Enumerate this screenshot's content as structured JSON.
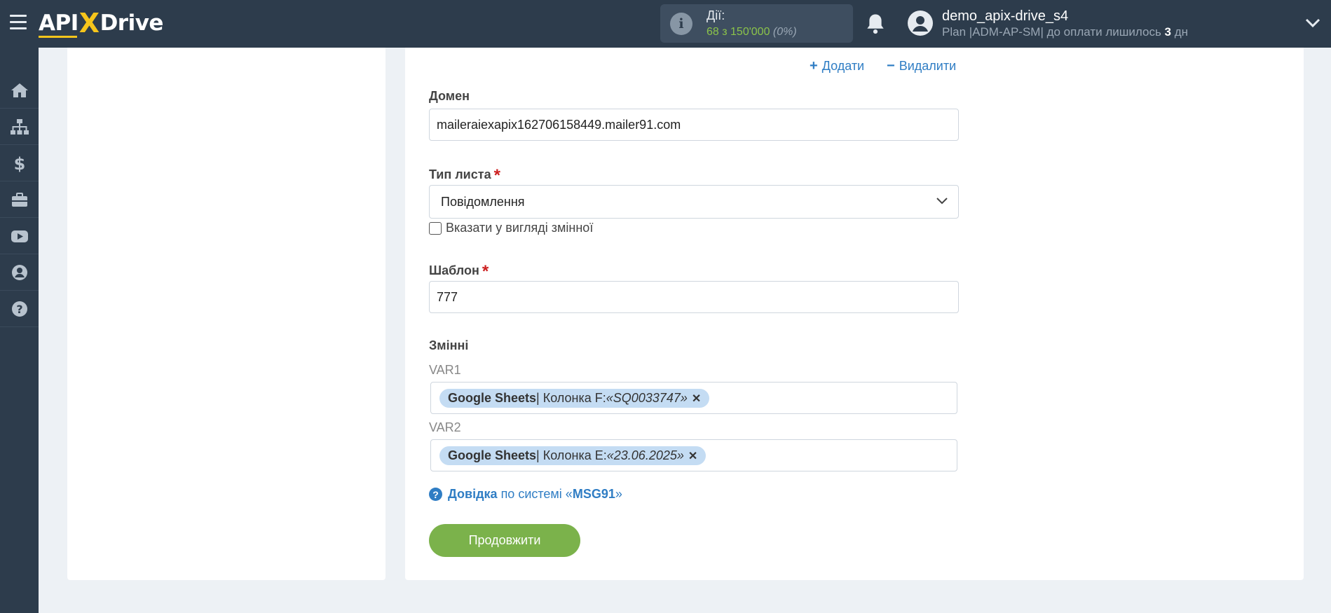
{
  "header": {
    "logo_prefix": "API",
    "logo_x": "X",
    "logo_suffix": "Drive",
    "actions_label": "Дії:",
    "actions_count": "68 з 150'000",
    "actions_percent": "(0%)",
    "username": "demo_apix-drive_s4",
    "plan_prefix": "Plan |ADM-AP-SM| до оплати лишилось ",
    "plan_days": "3",
    "plan_suffix": " дн"
  },
  "sidebar": {
    "items": [
      {
        "icon": "home-icon"
      },
      {
        "icon": "sitemap-icon"
      },
      {
        "icon": "dollar-icon"
      },
      {
        "icon": "briefcase-icon"
      },
      {
        "icon": "youtube-icon"
      },
      {
        "icon": "user-circle-icon"
      },
      {
        "icon": "question-circle-icon"
      }
    ]
  },
  "form": {
    "add_label": "Додати",
    "delete_label": "Видалити",
    "domain_label": "Домен",
    "domain_value": "maileraiexapix162706158449.mailer91.com",
    "letter_type_label": "Тип листа",
    "letter_type_value": "Повідомлення",
    "as_variable_label": "Вказати у вигляді змінної",
    "template_label": "Шаблон",
    "template_value": "777",
    "variables_label": "Змінні",
    "vars": [
      {
        "label": "VAR1",
        "source": "Google Sheets",
        "column": " | Колонка F: ",
        "value": "«SQ0033747»"
      },
      {
        "label": "VAR2",
        "source": "Google Sheets",
        "column": " | Колонка E: ",
        "value": "«23.06.2025»"
      }
    ],
    "help_link": "Довідка",
    "help_text": " по системі «",
    "help_system": "MSG91",
    "help_end": "»",
    "continue_label": "Продовжити"
  },
  "colors": {
    "topbar": "#2d3c4c",
    "accent_link": "#2f7dc4",
    "button_green": "#7bb24b",
    "tag_bg": "#c4dcf3",
    "required": "#cc1f1f"
  }
}
